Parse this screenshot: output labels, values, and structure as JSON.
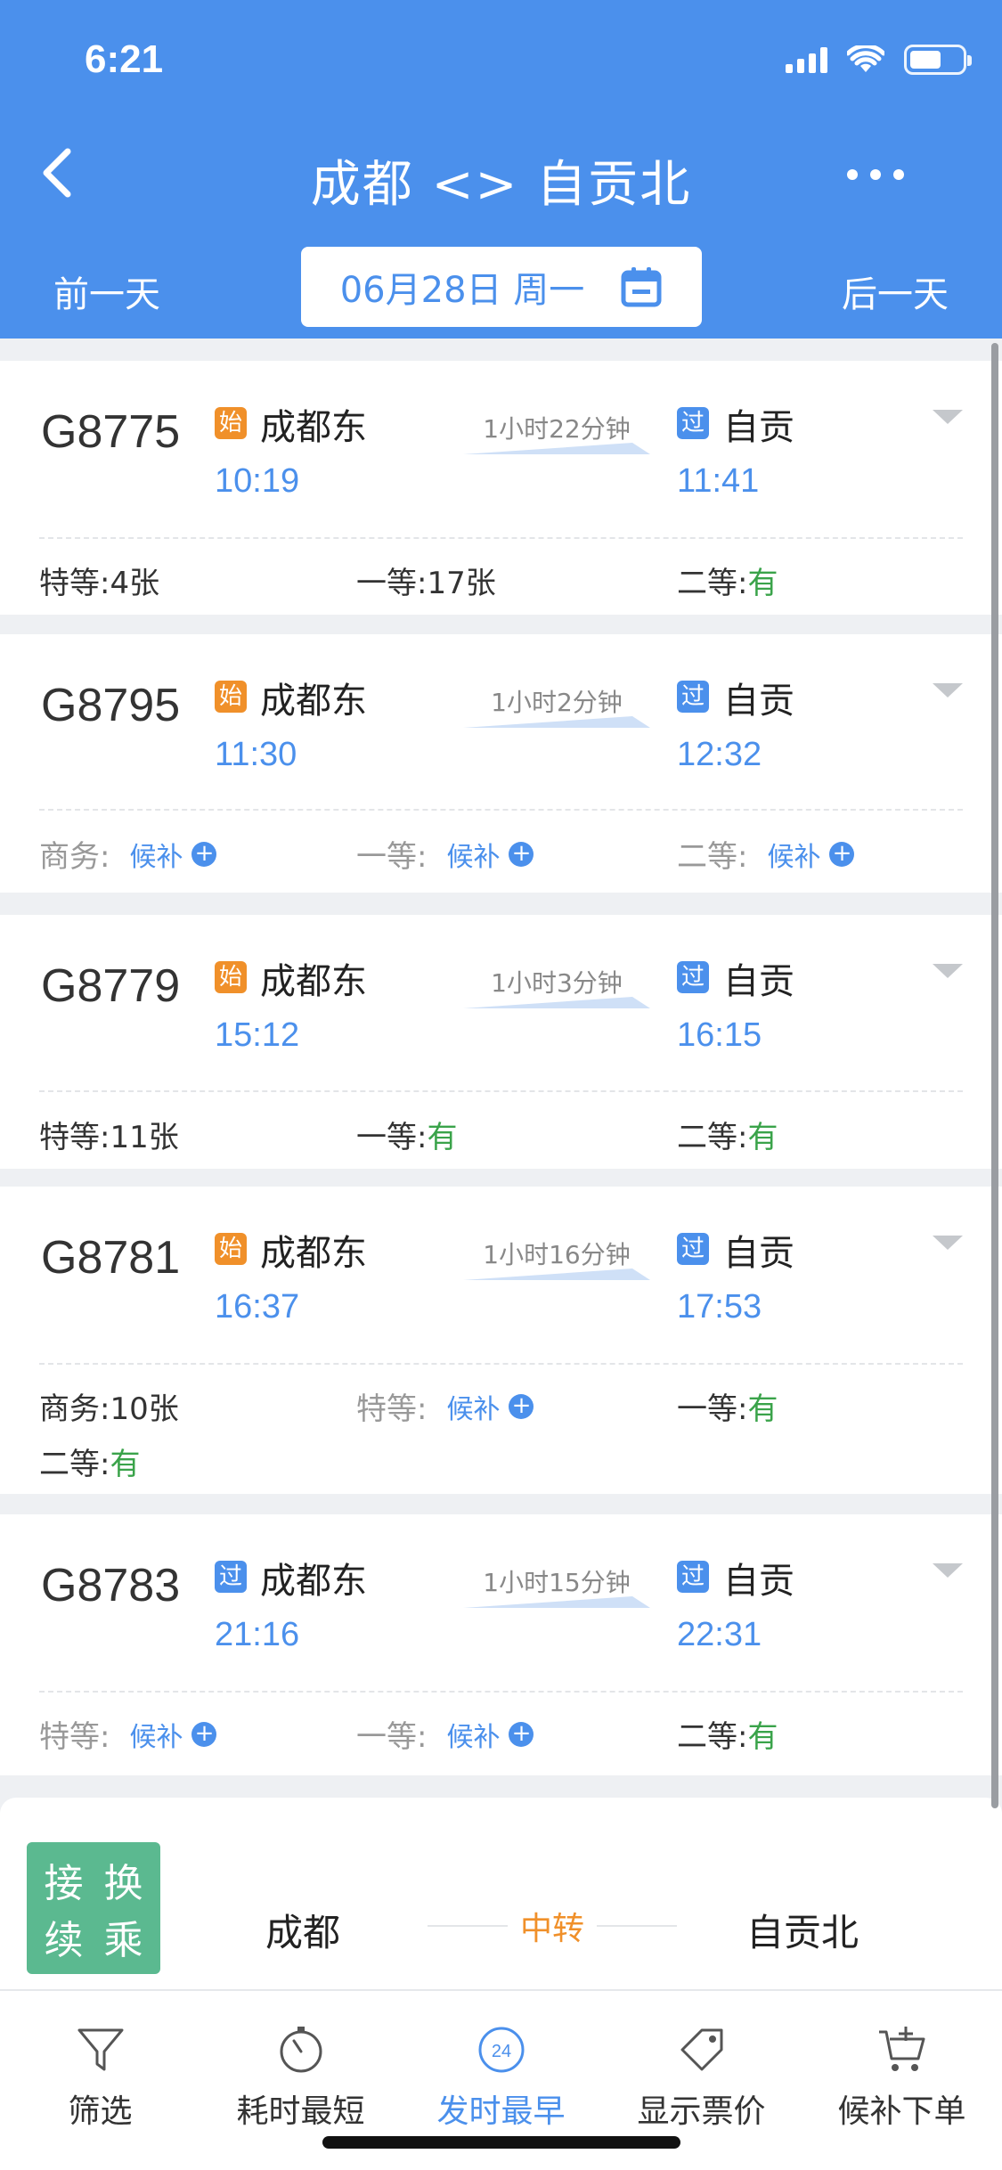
{
  "status": {
    "time": "6:21"
  },
  "nav": {
    "title": "成都 <> 自贡北"
  },
  "date_bar": {
    "prev": "前一天",
    "date": "06月28日 周一",
    "next": "后一天"
  },
  "trains": [
    {
      "no": "G8775",
      "from_badge": "始",
      "from": "成都东",
      "dep": "10:19",
      "duration": "1小时22分钟",
      "to_badge": "过",
      "to": "自贡",
      "arr": "11:41",
      "seats": [
        {
          "label": "特等:",
          "value": "4张",
          "type": "count"
        },
        {
          "label": "一等:",
          "value": "17张",
          "type": "count"
        },
        {
          "label": "二等:",
          "value": "有",
          "type": "avail"
        }
      ]
    },
    {
      "no": "G8795",
      "from_badge": "始",
      "from": "成都东",
      "dep": "11:30",
      "duration": "1小时2分钟",
      "to_badge": "过",
      "to": "自贡",
      "arr": "12:32",
      "seats": [
        {
          "label": "商务:",
          "value": "候补",
          "type": "wait"
        },
        {
          "label": "一等:",
          "value": "候补",
          "type": "wait"
        },
        {
          "label": "二等:",
          "value": "候补",
          "type": "wait"
        }
      ]
    },
    {
      "no": "G8779",
      "from_badge": "始",
      "from": "成都东",
      "dep": "15:12",
      "duration": "1小时3分钟",
      "to_badge": "过",
      "to": "自贡",
      "arr": "16:15",
      "seats": [
        {
          "label": "特等:",
          "value": "11张",
          "type": "count"
        },
        {
          "label": "一等:",
          "value": "有",
          "type": "avail"
        },
        {
          "label": "二等:",
          "value": "有",
          "type": "avail"
        }
      ]
    },
    {
      "no": "G8781",
      "from_badge": "始",
      "from": "成都东",
      "dep": "16:37",
      "duration": "1小时16分钟",
      "to_badge": "过",
      "to": "自贡",
      "arr": "17:53",
      "seats": [
        {
          "label": "商务:",
          "value": "10张",
          "type": "count"
        },
        {
          "label": "特等:",
          "value": "候补",
          "type": "wait"
        },
        {
          "label": "一等:",
          "value": "有",
          "type": "avail"
        },
        {
          "label": "二等:",
          "value": "有",
          "type": "avail"
        }
      ]
    },
    {
      "no": "G8783",
      "from_badge": "过",
      "from": "成都东",
      "dep": "21:16",
      "duration": "1小时15分钟",
      "to_badge": "过",
      "to": "自贡",
      "arr": "22:31",
      "seats": [
        {
          "label": "特等:",
          "value": "候补",
          "type": "wait"
        },
        {
          "label": "一等:",
          "value": "候补",
          "type": "wait"
        },
        {
          "label": "二等:",
          "value": "有",
          "type": "avail"
        }
      ]
    }
  ],
  "transfer": {
    "tag": [
      "接",
      "换",
      "续",
      "乘"
    ],
    "from": "成都",
    "middle": "中转",
    "to": "自贡北"
  },
  "toolbar": {
    "items": [
      {
        "label": "筛选",
        "icon": "filter-icon"
      },
      {
        "label": "耗时最短",
        "icon": "stopwatch-icon"
      },
      {
        "label": "发时最早",
        "icon": "clock-24-icon",
        "icon_text": "24"
      },
      {
        "label": "显示票价",
        "icon": "price-tag-icon"
      },
      {
        "label": "候补下单",
        "icon": "cart-plus-icon"
      }
    ]
  },
  "colors": {
    "primary": "#4b90ec",
    "orange": "#f0902a",
    "green": "#3aa34a",
    "transfer_green": "#5bb990"
  }
}
